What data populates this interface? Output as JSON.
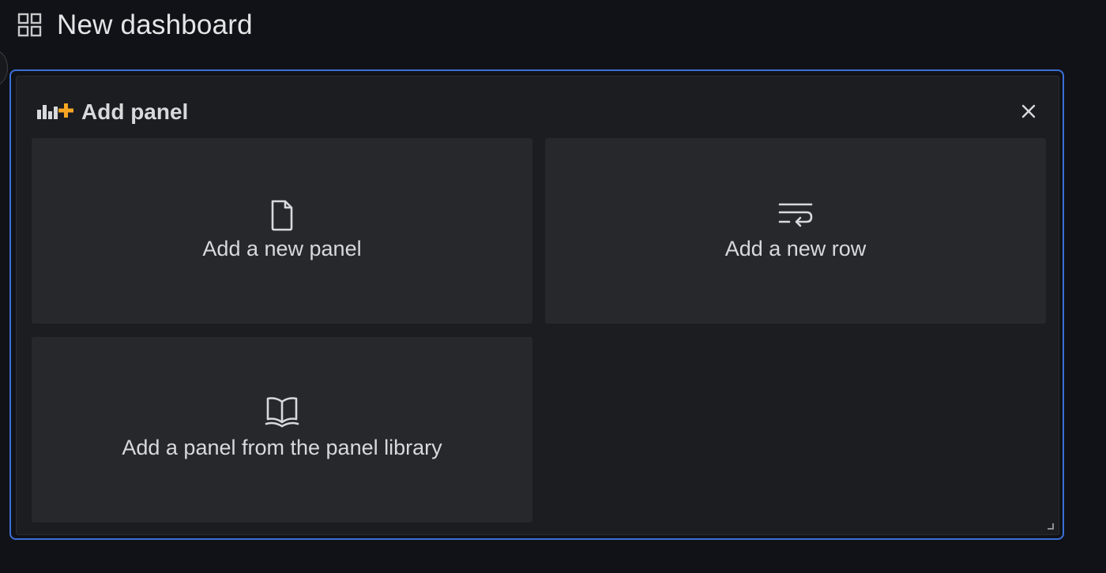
{
  "header": {
    "title": "New dashboard",
    "icon": "apps-grid-icon"
  },
  "add_panel": {
    "title": "Add panel",
    "icon": "add-panel-icon",
    "close_icon": "close-icon",
    "options": [
      {
        "label": "Add a new panel",
        "icon": "file-icon"
      },
      {
        "label": "Add a new row",
        "icon": "wrap-text-icon"
      },
      {
        "label": "Add a panel from the panel library",
        "icon": "book-open-icon"
      }
    ]
  },
  "colors": {
    "background": "#111217",
    "panel_bg": "#1c1d21",
    "tile_bg": "#27282c",
    "focus_border": "#3a6fd8",
    "accent_orange": "#f5a623",
    "text": "#d8d9da"
  }
}
